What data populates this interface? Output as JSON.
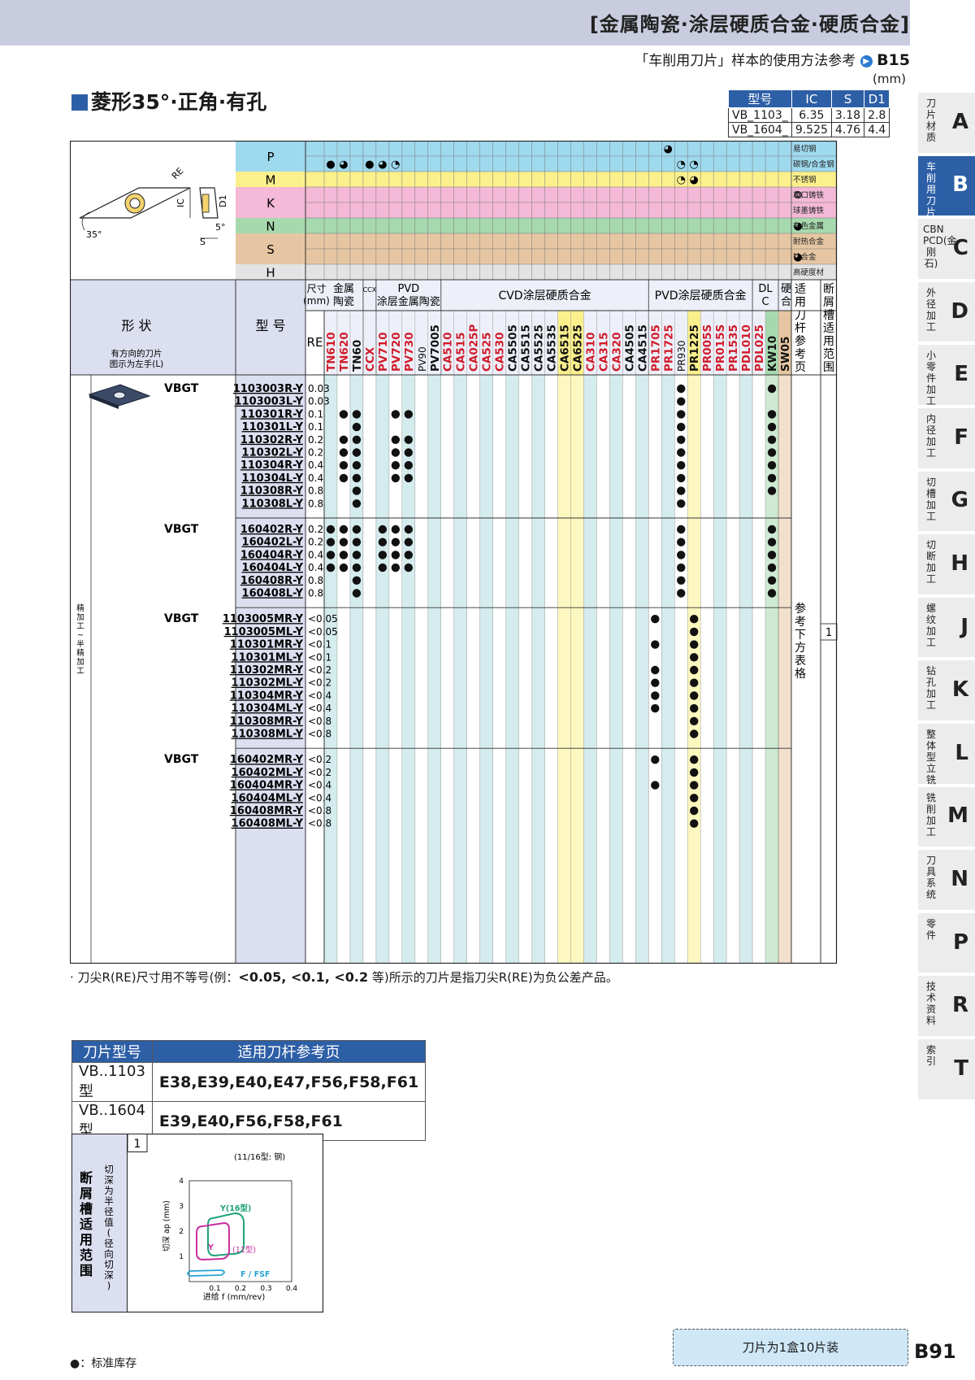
{
  "header": {
    "title": "[金属陶瓷·涂层硬质合金·硬质合金]",
    "ref_prefix": "「车削用刀片」样本的使用方法参考",
    "ref_page": "B15"
  },
  "section": {
    "title": "菱形35°·正角·有孔",
    "mm": "(mm)"
  },
  "spec": {
    "headers": [
      "型号",
      "IC",
      "S",
      "D1"
    ],
    "rows": [
      [
        "VB_1103_",
        "6.35",
        "3.18",
        "2.8"
      ],
      [
        "VB_1604_",
        "9.525",
        "4.76",
        "4.4"
      ]
    ]
  },
  "diagram": {
    "re": "RE",
    "ic": "IC",
    "d1": "D1",
    "angle35": "35°",
    "angle5": "5°",
    "s": "S"
  },
  "materials": [
    {
      "label": "P",
      "color": "#9fd9ee",
      "rows": [
        {
          "name": "易切钢"
        },
        {
          "name": "碳钢/合金钢"
        }
      ]
    },
    {
      "label": "M",
      "color": "#fbf08c",
      "rows": [
        {
          "name": "不锈钢"
        }
      ]
    },
    {
      "label": "K",
      "color": "#f3b9d6",
      "rows": [
        {
          "name": "灰口铸铁"
        },
        {
          "name": "球墨铸铁"
        }
      ]
    },
    {
      "label": "N",
      "color": "#a7d9ae",
      "rows": [
        {
          "name": "有色金属"
        }
      ]
    },
    {
      "label": "S",
      "color": "#e6c6a2",
      "rows": [
        {
          "name": "耐热合金"
        },
        {
          "name": "钛合金"
        }
      ]
    },
    {
      "label": "H",
      "color": "#e3e3e3",
      "rows": [
        {
          "name": "高硬度材"
        }
      ]
    }
  ],
  "marks": {
    "1-0": "●",
    "1-1": "◕",
    "1-3": "●",
    "1-4": "◕",
    "1-5": "◔",
    "0-26": "◕",
    "1-27": "◔",
    "1-28": "◔",
    "2-27": "◔",
    "2-28": "◕",
    "3-36": "⭗",
    "5-36": "◕",
    "7-36": "◕"
  },
  "col_groups": [
    {
      "name": "金属陶瓷",
      "span": 3
    },
    {
      "name": "CCX",
      "span": 1
    },
    {
      "name": "PVD涂层金属陶瓷",
      "span": 5
    },
    {
      "name": "CVD涂层硬质合金",
      "span": 16
    },
    {
      "name": "PVD涂层硬质合金",
      "span": 8
    },
    {
      "name": "DLC",
      "span": 2
    },
    {
      "name": "硬质合金",
      "span": 2
    }
  ],
  "grades": [
    {
      "name": "TN610",
      "color": "#d01c2c"
    },
    {
      "name": "TN620",
      "color": "#d01c2c"
    },
    {
      "name": "TN60",
      "color": "#111"
    },
    {
      "name": "CCX",
      "color": "#d01c2c"
    },
    {
      "name": "PV710",
      "color": "#d01c2c"
    },
    {
      "name": "PV720",
      "color": "#d01c2c"
    },
    {
      "name": "PV730",
      "color": "#d01c2c"
    },
    {
      "name": "PV90",
      "color": "#111",
      "thin": true
    },
    {
      "name": "PV7005",
      "color": "#111"
    },
    {
      "name": "CA510",
      "color": "#d01c2c"
    },
    {
      "name": "CA515",
      "color": "#d01c2c"
    },
    {
      "name": "CA025P",
      "color": "#d01c2c"
    },
    {
      "name": "CA525",
      "color": "#d01c2c"
    },
    {
      "name": "CA530",
      "color": "#d01c2c"
    },
    {
      "name": "CA5505",
      "color": "#111"
    },
    {
      "name": "CA5515",
      "color": "#111"
    },
    {
      "name": "CA5525",
      "color": "#111"
    },
    {
      "name": "CA5535",
      "color": "#111"
    },
    {
      "name": "CA6515",
      "color": "#111",
      "bg": "#fbf08c"
    },
    {
      "name": "CA6525",
      "color": "#111",
      "bg": "#fbf08c"
    },
    {
      "name": "CA310",
      "color": "#d01c2c"
    },
    {
      "name": "CA315",
      "color": "#d01c2c"
    },
    {
      "name": "CA320",
      "color": "#d01c2c"
    },
    {
      "name": "CA4505",
      "color": "#111"
    },
    {
      "name": "CA4515",
      "color": "#111"
    },
    {
      "name": "PR1705",
      "color": "#d01c2c"
    },
    {
      "name": "PR1725",
      "color": "#d01c2c"
    },
    {
      "name": "PR930",
      "color": "#111",
      "thin": true
    },
    {
      "name": "PR1225",
      "color": "#111",
      "bg": "#fbf08c"
    },
    {
      "name": "PR005S",
      "color": "#d01c2c"
    },
    {
      "name": "PR015S",
      "color": "#d01c2c"
    },
    {
      "name": "PR1535",
      "color": "#d01c2c"
    },
    {
      "name": "PDL010",
      "color": "#d01c2c"
    },
    {
      "name": "PDL025",
      "color": "#d01c2c"
    },
    {
      "name": "KW10",
      "color": "#111",
      "bg": "#a7d9ae"
    },
    {
      "name": "SW05",
      "color": "#111",
      "bg": "#e6c6a2"
    }
  ],
  "labels": {
    "size": "尺寸\n(mm)",
    "re": "RE",
    "shape": "形 状",
    "shape_note": "有方向的刀片\n图示为左手(L)",
    "model": "型 号",
    "holder_ref": "适用刀杆参考页",
    "chip_range": "断屑槽适用范围",
    "finish": "精加工~半精加工",
    "see_table": "参考下方表格",
    "chip_num": "1"
  },
  "groups": [
    {
      "prefix": "VBGT",
      "rows": [
        {
          "model": "1103003R-Y",
          "re": "0.03",
          "dots": [
            27,
            34
          ]
        },
        {
          "model": "1103003L-Y",
          "re": "0.03",
          "dots": [
            27
          ]
        },
        {
          "model": "110301R-Y",
          "re": "0.1",
          "dots": [
            1,
            2,
            5,
            6,
            27,
            34
          ]
        },
        {
          "model": "110301L-Y",
          "re": "0.1",
          "dots": [
            2,
            27,
            34
          ]
        },
        {
          "model": "110302R-Y",
          "re": "0.2",
          "dots": [
            1,
            2,
            5,
            6,
            27,
            34
          ]
        },
        {
          "model": "110302L-Y",
          "re": "0.2",
          "dots": [
            1,
            2,
            5,
            6,
            27,
            34
          ]
        },
        {
          "model": "110304R-Y",
          "re": "0.4",
          "dots": [
            1,
            2,
            5,
            6,
            27,
            34
          ]
        },
        {
          "model": "110304L-Y",
          "re": "0.4",
          "dots": [
            1,
            2,
            5,
            6,
            27,
            34
          ]
        },
        {
          "model": "110308R-Y",
          "re": "0.8",
          "dots": [
            2,
            27,
            34
          ]
        },
        {
          "model": "110308L-Y",
          "re": "0.8",
          "dots": [
            2,
            27
          ]
        }
      ]
    },
    {
      "prefix": "VBGT",
      "rows": [
        {
          "model": "160402R-Y",
          "re": "0.2",
          "dots": [
            0,
            1,
            2,
            4,
            5,
            6,
            27,
            34
          ]
        },
        {
          "model": "160402L-Y",
          "re": "0.2",
          "dots": [
            0,
            1,
            2,
            4,
            5,
            6,
            27,
            34
          ]
        },
        {
          "model": "160404R-Y",
          "re": "0.4",
          "dots": [
            0,
            1,
            2,
            4,
            5,
            6,
            27,
            34
          ]
        },
        {
          "model": "160404L-Y",
          "re": "0.4",
          "dots": [
            0,
            1,
            2,
            4,
            5,
            6,
            27,
            34
          ]
        },
        {
          "model": "160408R-Y",
          "re": "0.8",
          "dots": [
            2,
            27,
            34
          ]
        },
        {
          "model": "160408L-Y",
          "re": "0.8",
          "dots": [
            2,
            27,
            34
          ]
        }
      ]
    },
    {
      "prefix": "VBGT",
      "rows": [
        {
          "model": "1103005MR-Y",
          "re": "<0.05",
          "dots": [
            25,
            28
          ]
        },
        {
          "model": "1103005ML-Y",
          "re": "<0.05",
          "dots": [
            28
          ]
        },
        {
          "model": "110301MR-Y",
          "re": "<0.1",
          "dots": [
            25,
            28
          ]
        },
        {
          "model": "110301ML-Y",
          "re": "<0.1",
          "dots": [
            28
          ]
        },
        {
          "model": "110302MR-Y",
          "re": "<0.2",
          "dots": [
            25,
            28
          ]
        },
        {
          "model": "110302ML-Y",
          "re": "<0.2",
          "dots": [
            25,
            28
          ]
        },
        {
          "model": "110304MR-Y",
          "re": "<0.4",
          "dots": [
            25,
            28
          ]
        },
        {
          "model": "110304ML-Y",
          "re": "<0.4",
          "dots": [
            25,
            28
          ]
        },
        {
          "model": "110308MR-Y",
          "re": "<0.8",
          "dots": [
            28
          ]
        },
        {
          "model": "110308ML-Y",
          "re": "<0.8",
          "dots": [
            28
          ]
        }
      ]
    },
    {
      "prefix": "VBGT",
      "rows": [
        {
          "model": "160402MR-Y",
          "re": "<0.2",
          "dots": [
            25,
            28
          ]
        },
        {
          "model": "160402ML-Y",
          "re": "<0.2",
          "dots": [
            28
          ]
        },
        {
          "model": "160404MR-Y",
          "re": "<0.4",
          "dots": [
            25,
            28
          ]
        },
        {
          "model": "160404ML-Y",
          "re": "<0.4",
          "dots": [
            28
          ]
        },
        {
          "model": "160408MR-Y",
          "re": "<0.8",
          "dots": [
            28
          ]
        },
        {
          "model": "160408ML-Y",
          "re": "<0.8",
          "dots": [
            28
          ]
        }
      ]
    }
  ],
  "footnote": {
    "text": "· 刀尖R(RE)尺寸用不等号(例：",
    "bold": "<0.05, <0.1, <0.2",
    "tail": " 等)所示的刀片是指刀尖R(RE)为负公差产品。"
  },
  "holder": {
    "head": [
      "刀片型号",
      "适用刀杆参考页"
    ],
    "rows": [
      {
        "type": "VB..1103型",
        "pages": "E38,E39,E40,E47,F56,F58,F61"
      },
      {
        "type": "VB..1604型",
        "pages": "E39,E40,F56,F58,F61"
      }
    ]
  },
  "chip": {
    "title": "断屑槽适用范围",
    "side": "切深为半径值(径向切深)",
    "num": "1",
    "note": "(11/16型: 钢)",
    "ylabel": "切深 ap (mm)",
    "xlabel": "进给 f (mm/rev)",
    "yticks": [
      "1",
      "2",
      "3",
      "4"
    ],
    "xticks": [
      "0.1",
      "0.2",
      "0.3",
      "0.4"
    ],
    "y16": "Y(16型)",
    "y": "Y",
    "y11": "(11型)",
    "ffsf": "F / FSF"
  },
  "legend": "●：标准库存",
  "pack": "刀片为1盒10片装",
  "page": "B91",
  "tabs": [
    {
      "letter": "A",
      "label": "刀片材质"
    },
    {
      "letter": "B",
      "label": "车削用刀片",
      "active": true
    },
    {
      "letter": "C",
      "label": "CBN PCD(金刚石)"
    },
    {
      "letter": "D",
      "label": "外径加工"
    },
    {
      "letter": "E",
      "label": "小零件加工"
    },
    {
      "letter": "F",
      "label": "内径加工"
    },
    {
      "letter": "G",
      "label": "切槽加工"
    },
    {
      "letter": "H",
      "label": "切断加工"
    },
    {
      "letter": "J",
      "label": "螺纹加工"
    },
    {
      "letter": "K",
      "label": "钻孔加工"
    },
    {
      "letter": "L",
      "label": "整体型立铣刀"
    },
    {
      "letter": "M",
      "label": "铣削加工"
    },
    {
      "letter": "N",
      "label": "刀具系统"
    },
    {
      "letter": "P",
      "label": "零件"
    },
    {
      "letter": "R",
      "label": "技术资料"
    },
    {
      "letter": "T",
      "label": "索引"
    }
  ]
}
